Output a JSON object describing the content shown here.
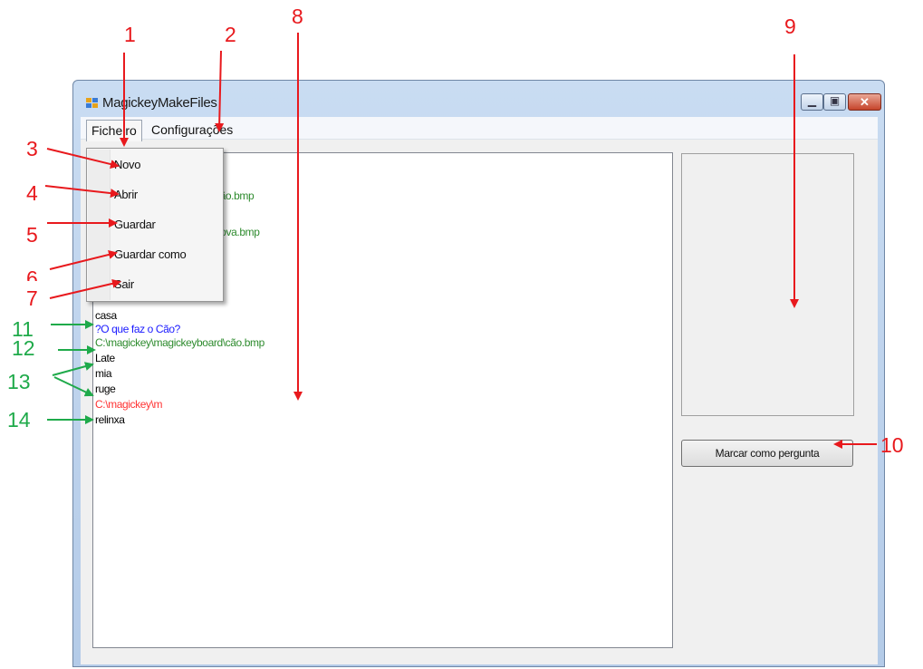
{
  "window": {
    "title": "MagickeyMakeFiles"
  },
  "menubar": {
    "ficheiro": "Ficheiro",
    "configuracoes": "Configurações"
  },
  "file_menu": {
    "items": [
      "Novo",
      "Abrir",
      "Guardar",
      "Guardar como",
      "Sair"
    ]
  },
  "editor": {
    "lines": [
      {
        "text": "cão.bmp",
        "color": "#2e8b2e"
      },
      {
        "text": "nova.bmp",
        "color": "#2e8b2e"
      },
      {
        "text": "casa",
        "color": "#000000"
      },
      {
        "text": "?O que faz o Cão?",
        "color": "#1a1aff"
      },
      {
        "text": "C:\\magickey\\magickeyboard\\cão.bmp",
        "color": "#2e8b2e"
      },
      {
        "text": "Late",
        "color": "#000000"
      },
      {
        "text": "mia",
        "color": "#000000"
      },
      {
        "text": "ruge",
        "color": "#000000"
      },
      {
        "text": "C:\\magickey\\m",
        "color": "#ff3333"
      },
      {
        "text": "relinxa",
        "color": "#000000"
      }
    ]
  },
  "buttons": {
    "mark_question": "Marcar como pergunta"
  },
  "annotations": {
    "red": [
      "1",
      "2",
      "3",
      "4",
      "5",
      "6",
      "7",
      "8",
      "9",
      "10"
    ],
    "green": [
      "11",
      "12",
      "13",
      "14"
    ]
  },
  "colors": {
    "annotation_red": "#e8191d",
    "annotation_green": "#1faa4a"
  }
}
